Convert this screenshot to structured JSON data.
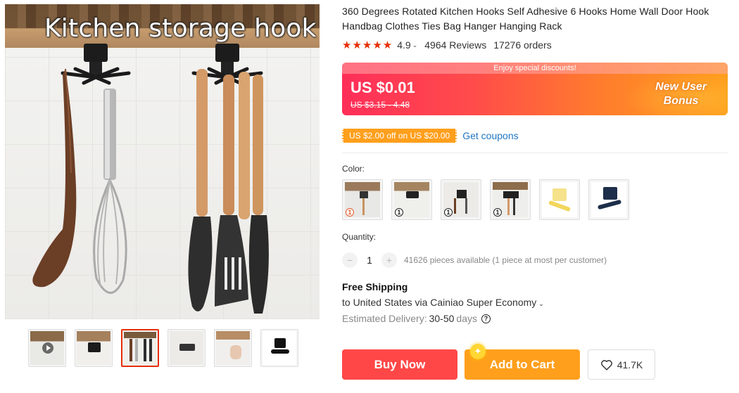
{
  "gallery": {
    "main_caption": "Kitchen storage hook",
    "thumbnails": [
      "thumb-video",
      "thumb-hook-shelf",
      "thumb-utensils",
      "thumb-hook-closeup",
      "thumb-hook-hand",
      "thumb-hook-black"
    ],
    "active_thumbnail": 2
  },
  "product": {
    "title": "360 Degrees Rotated Kitchen Hooks Self Adhesive 6 Hooks Home Wall Door Hook Handbag Clothes Ties Bag Hanger Hanging Rack",
    "rating_stars": "★★★★★",
    "rating": "4.9",
    "rating_caret": "⌄",
    "reviews": "4964 Reviews",
    "orders": "17276 orders"
  },
  "price": {
    "banner": "Enjoy special discounts!",
    "current": "US $0.01",
    "original": "US $3.15 - 4.48",
    "bonus_line1": "New User",
    "bonus_line2": "Bonus"
  },
  "coupon": {
    "badge": "US $2.00 off on US $20.00",
    "link": "Get coupons"
  },
  "color": {
    "label": "Color:",
    "options": [
      "swatch-1",
      "swatch-2",
      "swatch-3",
      "swatch-4",
      "swatch-yellow",
      "swatch-black"
    ],
    "number_badge": "1"
  },
  "quantity": {
    "label": "Quantity:",
    "minus": "−",
    "value": "1",
    "plus": "+",
    "available": "41626 pieces available (1 piece at most per customer)"
  },
  "shipping": {
    "title": "Free Shipping",
    "via": "to United States via Cainiao Super Economy",
    "caret": "⌄",
    "est_label": "Estimated Delivery:",
    "est_days": "30-50",
    "est_unit": "days",
    "help": "?"
  },
  "actions": {
    "buy_now": "Buy Now",
    "add_to_cart": "Add to Cart",
    "wishlist_count": "41.7K",
    "spark": "✦"
  },
  "colors": {
    "accent_red": "#ff4747",
    "accent_orange": "#ff9f1c",
    "star_red": "#e62e04",
    "link_blue": "#1f76c3"
  }
}
